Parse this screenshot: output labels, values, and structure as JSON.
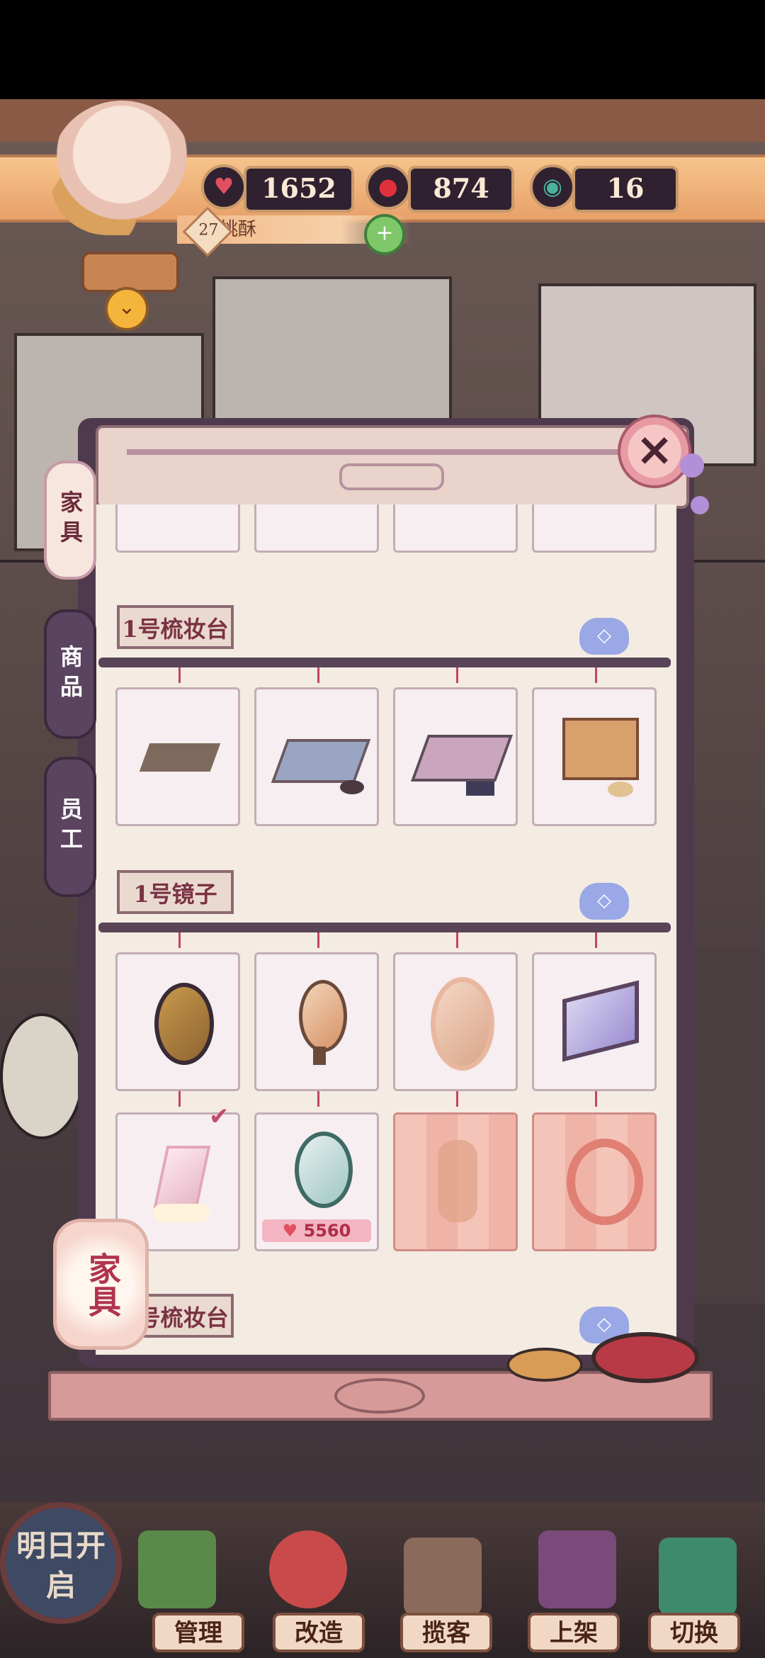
{
  "resources": {
    "hearts": "1652",
    "gems": "874",
    "tokens": "16"
  },
  "player": {
    "level": "27",
    "name": "桃酥"
  },
  "tabs": [
    {
      "label": "家具",
      "active": true
    },
    {
      "label": "商品",
      "active": false
    },
    {
      "label": "员工",
      "active": false
    }
  ],
  "panel": {
    "close_icon": "×",
    "sections": [
      {
        "label": "1号梳妆台"
      },
      {
        "label": "1号镜子"
      },
      {
        "label": "1号梳妆台"
      }
    ],
    "price": "5560"
  },
  "lantern_label": "家具",
  "open_button_label": "明日开启",
  "bottom_nav": [
    {
      "label": "管理"
    },
    {
      "label": "改造"
    },
    {
      "label": "揽客"
    },
    {
      "label": "上架"
    },
    {
      "label": "切换"
    }
  ],
  "colors": {
    "accent": "#b12c4a",
    "panel_dark": "#4f3a4d",
    "top_bar": "#f6c48c"
  }
}
